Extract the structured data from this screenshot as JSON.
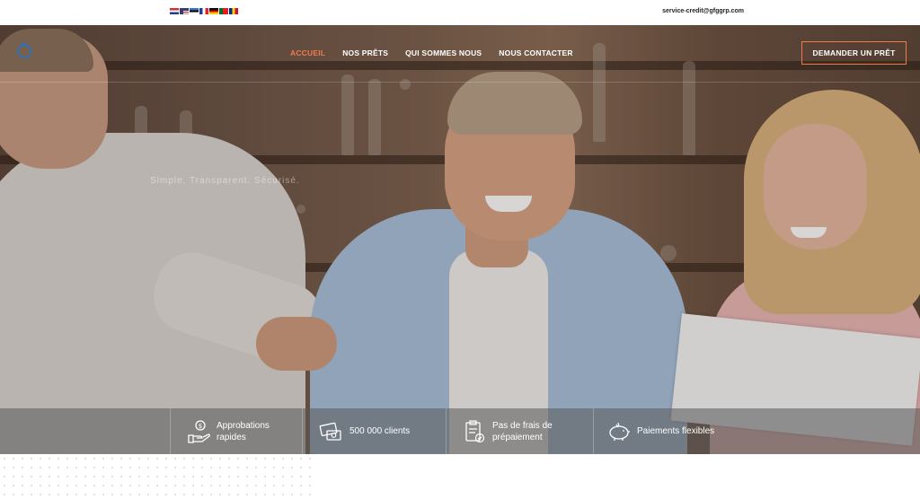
{
  "topbar": {
    "languages": [
      "hr",
      "en",
      "ee",
      "fr",
      "de",
      "pt",
      "ro"
    ],
    "email": "service-credit@gfggrp.com"
  },
  "nav": {
    "items": [
      {
        "label": "ACCUEIL",
        "active": true
      },
      {
        "label": "NOS PRÊTS",
        "active": false
      },
      {
        "label": "QUI SOMMES NOUS",
        "active": false
      },
      {
        "label": "NOUS CONTACTER",
        "active": false
      }
    ],
    "cta_label": "DEMANDER UN PRÊT"
  },
  "hero": {
    "tagline": "Simple. Transparent. Sécurisé."
  },
  "features": [
    {
      "icon": "hand-money-icon",
      "label_line1": "Approbations",
      "label_line2": "rapides"
    },
    {
      "icon": "card-cash-icon",
      "label_line1": "500 000 clients",
      "label_line2": ""
    },
    {
      "icon": "clipboard-check-icon",
      "label_line1": "Pas de frais de",
      "label_line2": "prépaiement"
    },
    {
      "icon": "piggy-bank-icon",
      "label_line1": "Paiements flexibles",
      "label_line2": ""
    }
  ],
  "colors": {
    "accent": "#f07a4c",
    "logo": "#2f6fb3"
  }
}
